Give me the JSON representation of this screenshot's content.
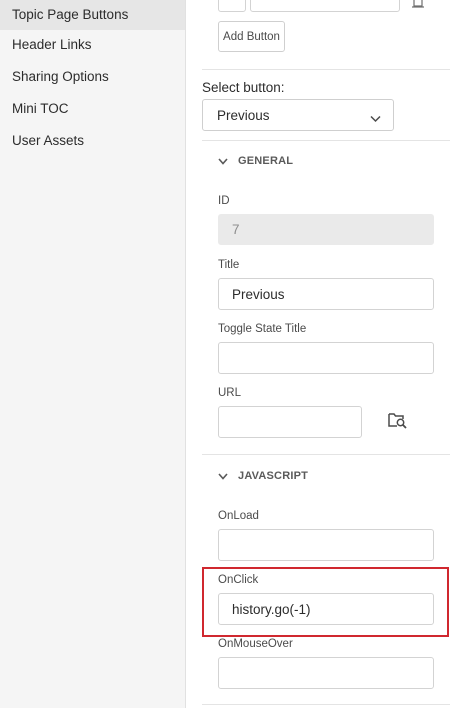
{
  "sidebar": {
    "items": [
      {
        "label": "Topic Page Buttons",
        "active": true
      },
      {
        "label": "Header Links",
        "active": false
      },
      {
        "label": "Sharing Options",
        "active": false
      },
      {
        "label": "Mini TOC",
        "active": false
      },
      {
        "label": "User Assets",
        "active": false
      }
    ]
  },
  "main": {
    "add_button_label": "Add Button",
    "select_button": {
      "label": "Select button:",
      "value": "Previous"
    },
    "general": {
      "heading": "GENERAL",
      "id_label": "ID",
      "id_value": "7",
      "title_label": "Title",
      "title_value": "Previous",
      "toggle_state_title_label": "Toggle State Title",
      "toggle_state_title_value": "",
      "url_label": "URL",
      "url_value": ""
    },
    "javascript": {
      "heading": "JAVASCRIPT",
      "onload_label": "OnLoad",
      "onload_value": "",
      "onclick_label": "OnClick",
      "onclick_value": "history.go(-1)",
      "onmouseover_label": "OnMouseOver",
      "onmouseover_value": ""
    }
  },
  "colors": {
    "sidebar_bg": "#f5f5f5",
    "sidebar_active": "#e6e6e6",
    "highlight": "#d0282f",
    "readonly_field": "#eaeaea"
  },
  "icons": {
    "browse": "folder-search-icon",
    "collapse": "chevron-down-icon",
    "dropdown": "chevron-down-icon",
    "delete": "trash-icon"
  }
}
